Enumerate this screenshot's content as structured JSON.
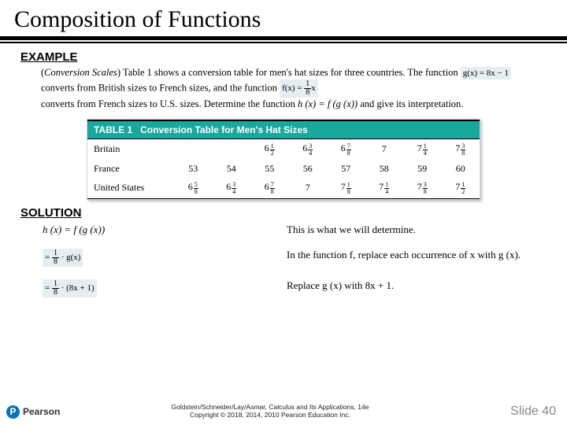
{
  "title": "Composition of Functions",
  "example_label": "EXAMPLE",
  "problem": {
    "topic": "Conversion Scales",
    "pre_g": ") Table 1 shows a conversion table for men's hat sizes for three countries.  The function ",
    "g_eq": {
      "lhs": "g(x) = 8x − 1"
    },
    "mid": " converts from British sizes to French sizes, and the function ",
    "f_eq": {
      "lhs": "f(x) = ",
      "num": "1",
      "den": "8",
      "rhs": "x"
    },
    "post": "converts from French sizes to U.S. sizes.  Determine the function ",
    "hdef": "h (x) = f (g (x))",
    "tail": " and give its interpretation."
  },
  "table": {
    "caption_strong": "TABLE 1",
    "caption_rest": "Conversion Table for Men's Hat Sizes",
    "rows": [
      {
        "label": "Britain",
        "cells": [
          {
            "w": "6",
            "n": "1",
            "d": "2"
          },
          {
            "w": "6",
            "n": "3",
            "d": "4"
          },
          {
            "w": "6",
            "n": "7",
            "d": "8"
          },
          {
            "w": "7"
          },
          {
            "w": "7",
            "n": "1",
            "d": "4"
          },
          {
            "w": "7",
            "n": "3",
            "d": "8"
          }
        ]
      },
      {
        "label": "France",
        "cells": [
          {
            "w": "53"
          },
          {
            "w": "54"
          },
          {
            "w": "55"
          },
          {
            "w": "56"
          },
          {
            "w": "57"
          },
          {
            "w": "58"
          },
          {
            "w": "59"
          },
          {
            "w": "60"
          }
        ]
      },
      {
        "label": "United States",
        "cells": [
          {
            "w": "6",
            "n": "5",
            "d": "8"
          },
          {
            "w": "6",
            "n": "3",
            "d": "4"
          },
          {
            "w": "6",
            "n": "7",
            "d": "8"
          },
          {
            "w": "7"
          },
          {
            "w": "7",
            "n": "1",
            "d": "8"
          },
          {
            "w": "7",
            "n": "1",
            "d": "4"
          },
          {
            "w": "7",
            "n": "3",
            "d": "8"
          },
          {
            "w": "7",
            "n": "1",
            "d": "2"
          }
        ]
      }
    ]
  },
  "solution_label": "SOLUTION",
  "solution": [
    {
      "lhs_text": "h (x) = f (g (x))",
      "rhs": "This is what we will determine."
    },
    {
      "lhs_eq": {
        "pre": "= ",
        "num": "1",
        "den": "8",
        "post": "· g(x)"
      },
      "rhs": "In the function f, replace each occurrence of x with g (x)."
    },
    {
      "lhs_eq": {
        "pre": "= ",
        "num": "1",
        "den": "8",
        "post": "· (8x + 1)"
      },
      "rhs": "Replace g (x) with 8x + 1."
    }
  ],
  "footer": {
    "logo_letter": "P",
    "logo_word": "Pearson",
    "line1": "Goldstein/Schneider/Lay/Asmar, Calculus and Its Applications, 14e",
    "line2": "Copyright © 2018, 2014, 2010 Pearson Education Inc.",
    "slide": "Slide 40"
  }
}
